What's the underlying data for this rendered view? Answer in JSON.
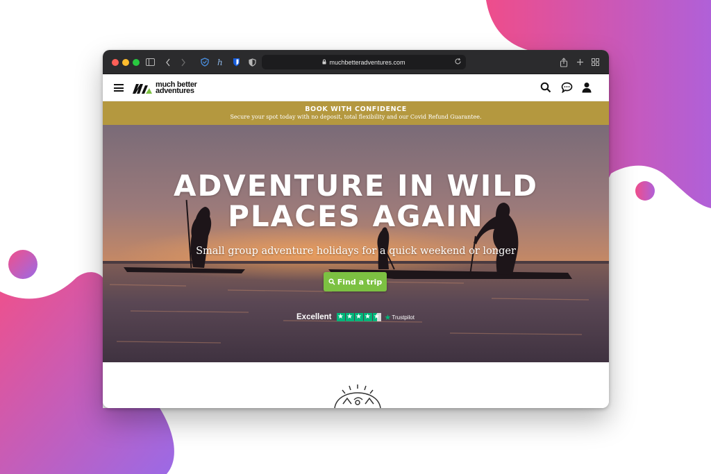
{
  "colors": {
    "gradient_pink": "#ef4f8a",
    "gradient_purple": "#a566e0",
    "banner_gold": "#b4983f",
    "cta_green": "#7cc142",
    "trustpilot_green": "#00b67a",
    "toolbar_dark": "#2b2b2d"
  },
  "browser": {
    "url": "muchbetteradventures.com",
    "icons": [
      "sidebar-icon",
      "back-icon",
      "forward-icon",
      "shield-extension-icon",
      "honey-extension-icon",
      "bitwarden-icon",
      "privacy-shield-icon",
      "lock-icon",
      "reload-icon",
      "share-icon",
      "new-tab-icon",
      "tab-overview-icon"
    ]
  },
  "header": {
    "logo_line1": "much better",
    "logo_line2": "adventures",
    "icons": [
      "menu-icon",
      "search-icon",
      "chat-icon",
      "account-icon"
    ]
  },
  "banner": {
    "title": "BOOK WITH CONFIDENCE",
    "subtitle": "Secure your spot today with no deposit, total flexibility and our Covid Refund Guarantee."
  },
  "hero": {
    "title_line1": "ADVENTURE IN WILD",
    "title_line2": "PLACES AGAIN",
    "subtitle": "Small group adventure holidays for a quick weekend or longer",
    "cta_label": "Find a trip",
    "trust_rating": "Excellent",
    "trust_brand": "Trustpilot",
    "trust_stars": 4.5
  }
}
